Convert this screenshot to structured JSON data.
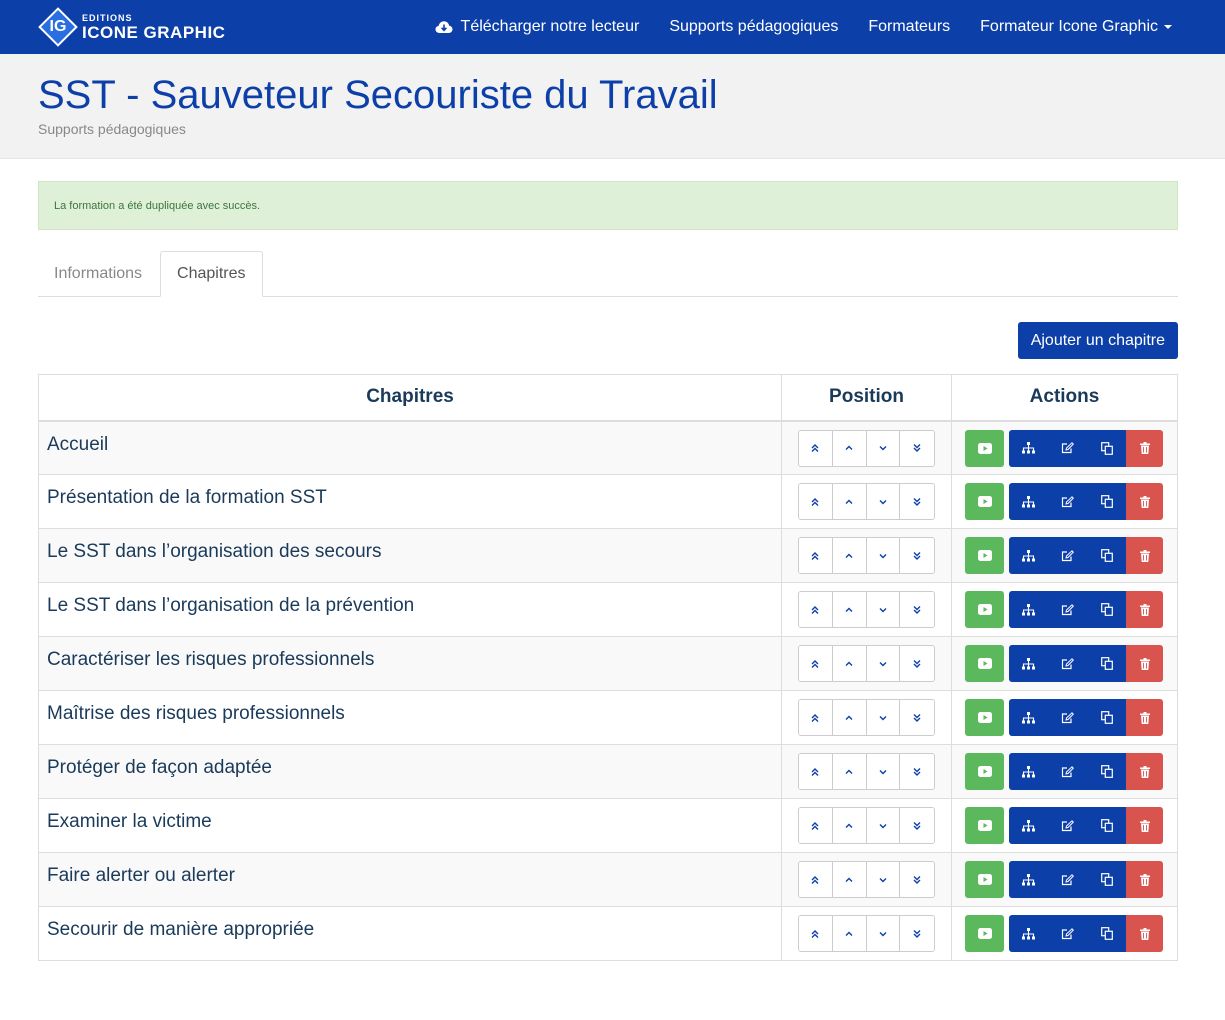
{
  "brand": {
    "logo_letters": "IG",
    "top": "EDITIONS",
    "bottom": "ICONE GRAPHIC"
  },
  "nav": {
    "download": {
      "label": "Télécharger notre lecteur",
      "icon": "cloud-download-icon"
    },
    "supports": "Supports pédagogiques",
    "trainers": "Formateurs",
    "user_menu": "Formateur Icone Graphic"
  },
  "header": {
    "title": "SST - Sauveteur Secouriste du Travail",
    "subtitle": "Supports pédagogiques"
  },
  "alert": {
    "message": "La formation a été dupliquée avec succès."
  },
  "tabs": [
    {
      "label": "Informations",
      "active": false
    },
    {
      "label": "Chapitres",
      "active": true
    }
  ],
  "toolbar": {
    "add_label": "Ajouter un chapitre"
  },
  "table": {
    "headers": [
      "Chapitres",
      "Position",
      "Actions"
    ],
    "rows": [
      {
        "name": "Accueil"
      },
      {
        "name": "Présentation de la formation SST"
      },
      {
        "name": "Le SST dans l’organisation des secours"
      },
      {
        "name": "Le SST dans l’organisation de la prévention"
      },
      {
        "name": "Caractériser les risques professionnels"
      },
      {
        "name": "Maîtrise des risques professionnels"
      },
      {
        "name": "Protéger de façon adaptée"
      },
      {
        "name": "Examiner la victime"
      },
      {
        "name": "Faire alerter ou alerter"
      },
      {
        "name": "Secourir de manière appropriée"
      }
    ]
  },
  "colors": {
    "primary": "#0c3fa8",
    "success": "#5cb85c",
    "danger": "#d9534f",
    "alert_bg": "#dff0d8",
    "alert_text": "#3c763d"
  },
  "icons": {
    "position": [
      "double-chevron-up-icon",
      "chevron-up-icon",
      "chevron-down-icon",
      "double-chevron-down-icon"
    ],
    "actions": [
      "play-icon",
      "sitemap-icon",
      "edit-icon",
      "copy-icon",
      "trash-icon"
    ]
  }
}
